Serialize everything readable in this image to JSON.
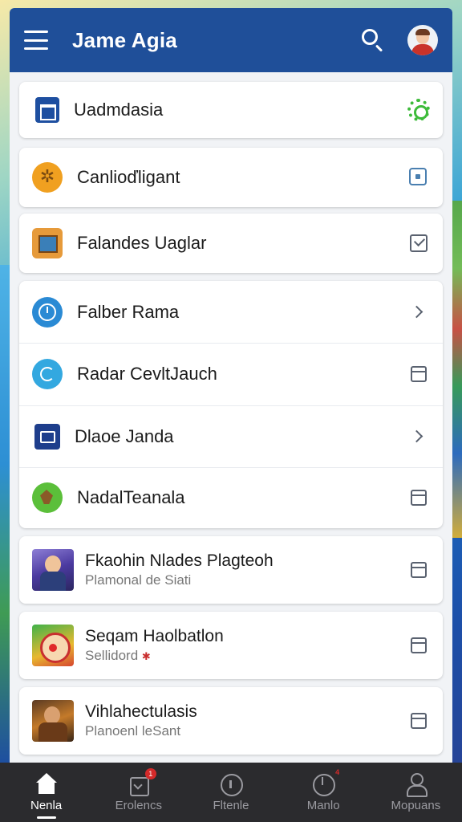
{
  "appbar": {
    "title": "Jame Agia",
    "icons": {
      "menu": "menu-icon",
      "search": "search-icon",
      "avatar": "avatar"
    },
    "color": "#1f4f99"
  },
  "list": {
    "single_items": [
      {
        "label": "Uadmdasia",
        "icon": "map-icon",
        "trailing": "settings-icon"
      },
      {
        "label": "Canlioďligant",
        "icon": "emblem-icon",
        "trailing": "record-icon"
      },
      {
        "label": "Falandes Uaglar",
        "icon": "box-icon",
        "trailing": "checkbox-icon"
      }
    ],
    "group_items": [
      {
        "label": "Falber Rama",
        "icon": "clock-icon",
        "trailing": "chevron-right-icon"
      },
      {
        "label": "Radar CevltJauch",
        "icon": "radar-icon",
        "trailing": "archive-icon"
      },
      {
        "label": "Dlaoe Janda",
        "icon": "window-icon",
        "trailing": "chevron-right-icon"
      },
      {
        "label": "NadalTeanala",
        "icon": "leaf-icon",
        "trailing": "archive-icon"
      }
    ],
    "media_items": [
      {
        "primary": "Fkaohin Nlades Plagteoh",
        "secondary": "Plamonal de Siati",
        "thumb": "knight-thumbnail",
        "trailing": "archive-icon"
      },
      {
        "primary": "Seqam Haolbatlon",
        "secondary": "Sellidord",
        "secondary_mark": "✱",
        "thumb": "clown-thumbnail",
        "trailing": "archive-icon"
      },
      {
        "primary": "Vihlahectulasis",
        "secondary": "Planoenl leSant",
        "thumb": "warrior-thumbnail",
        "trailing": "archive-icon"
      }
    ]
  },
  "bottom_nav": {
    "items": [
      {
        "label": "Nenla",
        "icon": "home-icon",
        "active": true
      },
      {
        "label": "Erolencs",
        "icon": "bag-icon",
        "badge": "1"
      },
      {
        "label": "Fltenle",
        "icon": "info-circle-icon"
      },
      {
        "label": "Manlo",
        "icon": "gauge-icon",
        "badge": "4"
      },
      {
        "label": "Mopuans",
        "icon": "person-icon"
      }
    ]
  },
  "colors": {
    "accent": "#1f4f99",
    "nav_bg": "#2b2b2e",
    "status_green": "#3dbb3a"
  }
}
